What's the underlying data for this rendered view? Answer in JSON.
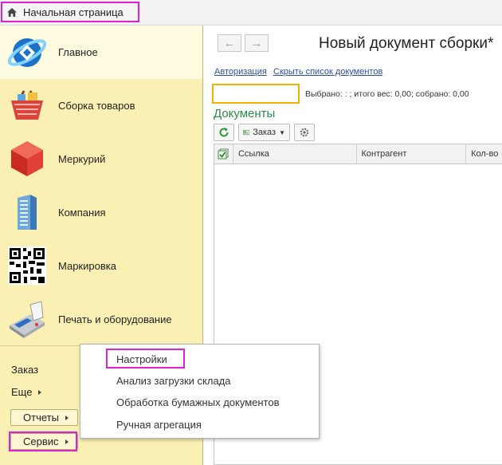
{
  "top_tab": {
    "label": "Начальная страница",
    "icon": "home-icon"
  },
  "sidebar": {
    "items": [
      {
        "label": "Главное",
        "icon": "globe-icon"
      },
      {
        "label": "Сборка товаров",
        "icon": "basket-icon"
      },
      {
        "label": "Меркурий",
        "icon": "cube-icon"
      },
      {
        "label": "Компания",
        "icon": "building-icon"
      },
      {
        "label": "Маркировка",
        "icon": "qr-code-icon"
      },
      {
        "label": "Печать и оборудование",
        "icon": "payment-terminal-icon"
      }
    ],
    "bottom": {
      "order_label": "Заказ",
      "more_label": "Еще",
      "reports_label": "Отчеты",
      "service_label": "Сервис"
    }
  },
  "document": {
    "title": "Новый документ сборки*",
    "links": {
      "authorization": "Авторизация",
      "hide_list": "Скрыть список документов"
    },
    "barcode_input_value": "",
    "selected_info": "Выбрано: : ; итого вес: 0,00; собрано: 0,00",
    "section_title": "Документы",
    "toolbar": {
      "order_label": "Заказ"
    },
    "columns": [
      "Ссылка",
      "Контрагент",
      "Кол-во"
    ]
  },
  "popup_menu": {
    "items": [
      "Настройки",
      "Анализ загрузки склада",
      "Обработка бумажных документов",
      "Ручная агрегация"
    ]
  },
  "colors": {
    "highlight": "#e020d6",
    "sidebar": "#fbf0b3",
    "section_title": "#2b8a4a",
    "link": "#2b4fa8",
    "input_border": "#f0b400"
  }
}
